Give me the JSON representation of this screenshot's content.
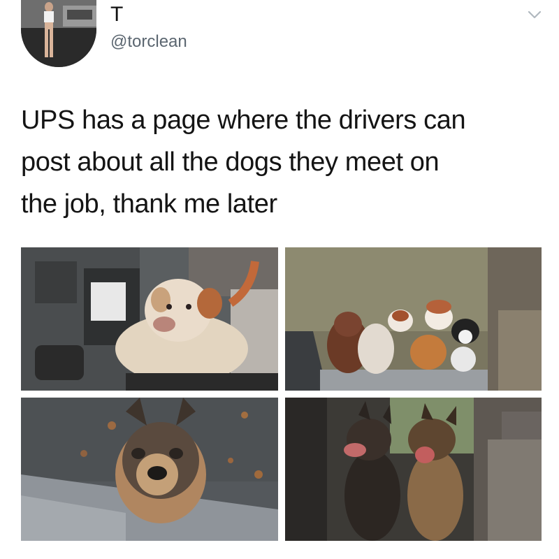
{
  "author": {
    "display_name": "T",
    "handle": "@torclean"
  },
  "icons": {
    "menu": "chevron-down-icon"
  },
  "tweet": {
    "text_lines": [
      "UPS has a page where the drivers can",
      "post about all the dogs they meet on",
      "the job, thank me later"
    ]
  },
  "colors": {
    "text": "#141414",
    "handle": "#5b6670",
    "chevron": "#b0b8bf"
  }
}
